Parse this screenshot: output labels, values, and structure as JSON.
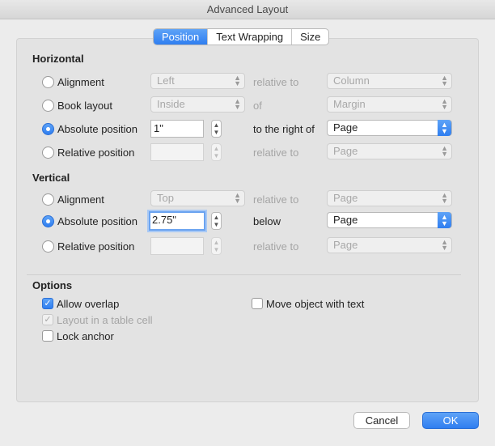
{
  "window": {
    "title": "Advanced Layout"
  },
  "tabs": [
    {
      "label": "Position",
      "active": true
    },
    {
      "label": "Text Wrapping",
      "active": false
    },
    {
      "label": "Size",
      "active": false
    }
  ],
  "horizontal": {
    "heading": "Horizontal",
    "alignment": {
      "label": "Alignment",
      "value": "Left",
      "relation": "relative to",
      "target": "Column"
    },
    "book_layout": {
      "label": "Book layout",
      "value": "Inside",
      "relation": "of",
      "target": "Margin"
    },
    "absolute_position": {
      "label": "Absolute position",
      "value": "1\"",
      "relation": "to the right of",
      "target": "Page",
      "checked": true
    },
    "relative_position": {
      "label": "Relative position",
      "value": "",
      "relation": "relative to",
      "target": "Page"
    }
  },
  "vertical": {
    "heading": "Vertical",
    "alignment": {
      "label": "Alignment",
      "value": "Top",
      "relation": "relative to",
      "target": "Page"
    },
    "absolute_position": {
      "label": "Absolute position",
      "value": "2.75\"",
      "relation": "below",
      "target": "Page",
      "checked": true
    },
    "relative_position": {
      "label": "Relative position",
      "value": "",
      "relation": "relative to",
      "target": "Page"
    }
  },
  "options": {
    "heading": "Options",
    "allow_overlap": {
      "label": "Allow overlap",
      "checked": true
    },
    "layout_in_table_cell": {
      "label": "Layout in a table cell",
      "checked": true,
      "disabled": true
    },
    "lock_anchor": {
      "label": "Lock anchor",
      "checked": false
    },
    "move_object_with_text": {
      "label": "Move object with text",
      "checked": false
    }
  },
  "buttons": {
    "cancel": "Cancel",
    "ok": "OK"
  },
  "colors": {
    "accent": "#2f7ef0",
    "background": "#ececec",
    "disabled_text": "#a5a5a5"
  }
}
